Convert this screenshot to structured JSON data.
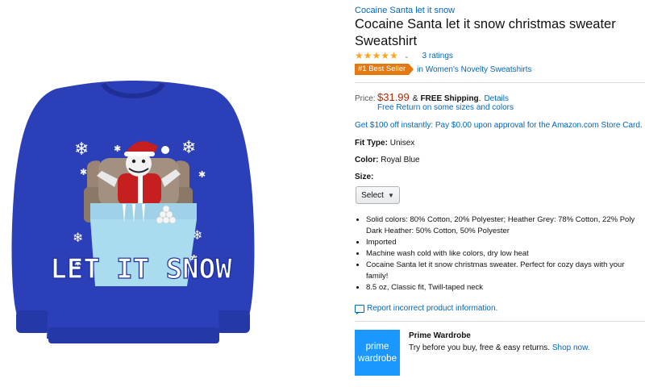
{
  "product": {
    "brand": "Cocaine Santa let it snow",
    "title": "Cocaine Santa let it snow christmas sweater Sweatshirt",
    "rating_count": "3 ratings",
    "best_seller_badge": "#1 Best Seller",
    "best_seller_category": "in Women's Novelty Sweatshirts",
    "image_text": "LET IT SNOW",
    "sweater_color": "#2a3fb8"
  },
  "price": {
    "label": "Price:",
    "amount": "$31.99",
    "amp": "&",
    "free_shipping": "FREE Shipping",
    "period": ".",
    "details_link": "Details",
    "free_return": "Free Return on some sizes and colors"
  },
  "promo": "Get $100 off instantly: Pay $0.00 upon approval for the Amazon.com Store Card.",
  "options": {
    "fit_label": "Fit Type:",
    "fit_value": "Unisex",
    "color_label": "Color:",
    "color_value": "Royal Blue",
    "size_label": "Size:",
    "size_select": "Select"
  },
  "bullets": [
    "Solid colors: 80% Cotton, 20% Polyester; Heather Grey: 78% Cotton, 22% Poly",
    "Dark Heather: 50% Cotton, 50% Polyester",
    "Imported",
    "Machine wash cold with like colors, dry low heat",
    "Cocaine Santa let it snow christmas sweater. Perfect for cozy days with your",
    "family!",
    "8.5 oz, Classic fit, Twill-taped neck"
  ],
  "report_link": "Report incorrect product information.",
  "prime_wardrobe": {
    "logo_line1": "prime",
    "logo_line2": "wardrobe",
    "title": "Prime Wardrobe",
    "desc": "Try before you buy, free & easy returns.",
    "link": "Shop now."
  },
  "colors": {
    "link": "#0066c0",
    "price": "#b12704",
    "badge": "#e47911",
    "star": "#ffa41c",
    "prime_blue": "#1a98ff"
  }
}
